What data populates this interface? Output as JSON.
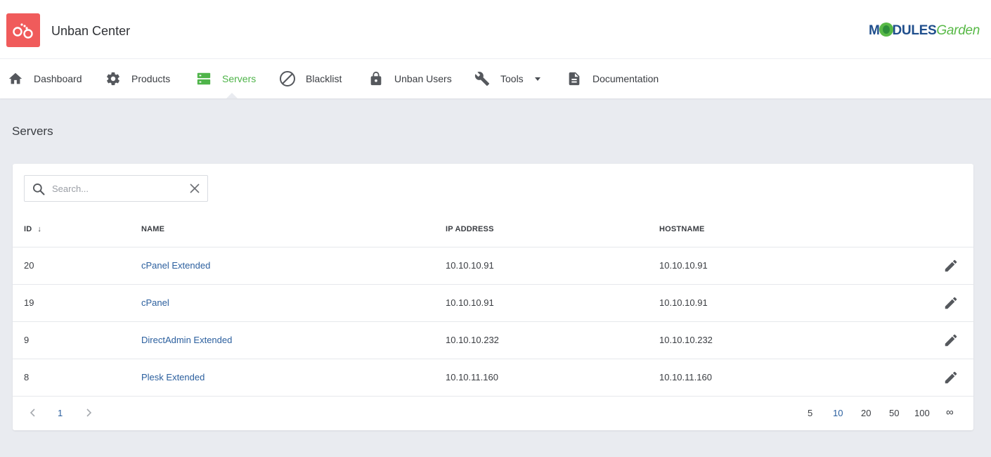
{
  "app": {
    "title": "Unban Center",
    "brand_a": "M",
    "brand_b": "DULES",
    "brand_c": "Garden"
  },
  "nav": [
    {
      "label": "Dashboard",
      "icon": "home-icon"
    },
    {
      "label": "Products",
      "icon": "gear-icon"
    },
    {
      "label": "Servers",
      "icon": "server-icon",
      "active": true
    },
    {
      "label": "Blacklist",
      "icon": "block-icon"
    },
    {
      "label": "Unban Users",
      "icon": "lock-icon"
    },
    {
      "label": "Tools",
      "icon": "wrench-icon"
    },
    {
      "label": "Documentation",
      "icon": "document-icon"
    }
  ],
  "page": {
    "title": "Servers"
  },
  "search": {
    "placeholder": "Search..."
  },
  "table": {
    "headers": {
      "id": "ID",
      "sort": "↓",
      "name": "NAME",
      "ip": "IP ADDRESS",
      "hostname": "HOSTNAME"
    },
    "rows": [
      {
        "id": "20",
        "name": "cPanel Extended",
        "ip": "10.10.10.91",
        "hostname": "10.10.10.91"
      },
      {
        "id": "19",
        "name": "cPanel",
        "ip": "10.10.10.91",
        "hostname": "10.10.10.91"
      },
      {
        "id": "9",
        "name": "DirectAdmin Extended",
        "ip": "10.10.10.232",
        "hostname": "10.10.10.232"
      },
      {
        "id": "8",
        "name": "Plesk Extended",
        "ip": "10.10.11.160",
        "hostname": "10.10.11.160"
      }
    ]
  },
  "pagination": {
    "current_page": "1",
    "sizes": [
      "5",
      "10",
      "20",
      "50",
      "100",
      "∞"
    ],
    "selected_size": "10"
  },
  "colors": {
    "accent": "#4fb44a",
    "link": "#2b5f9e",
    "logo_bg": "#f05b5b"
  }
}
